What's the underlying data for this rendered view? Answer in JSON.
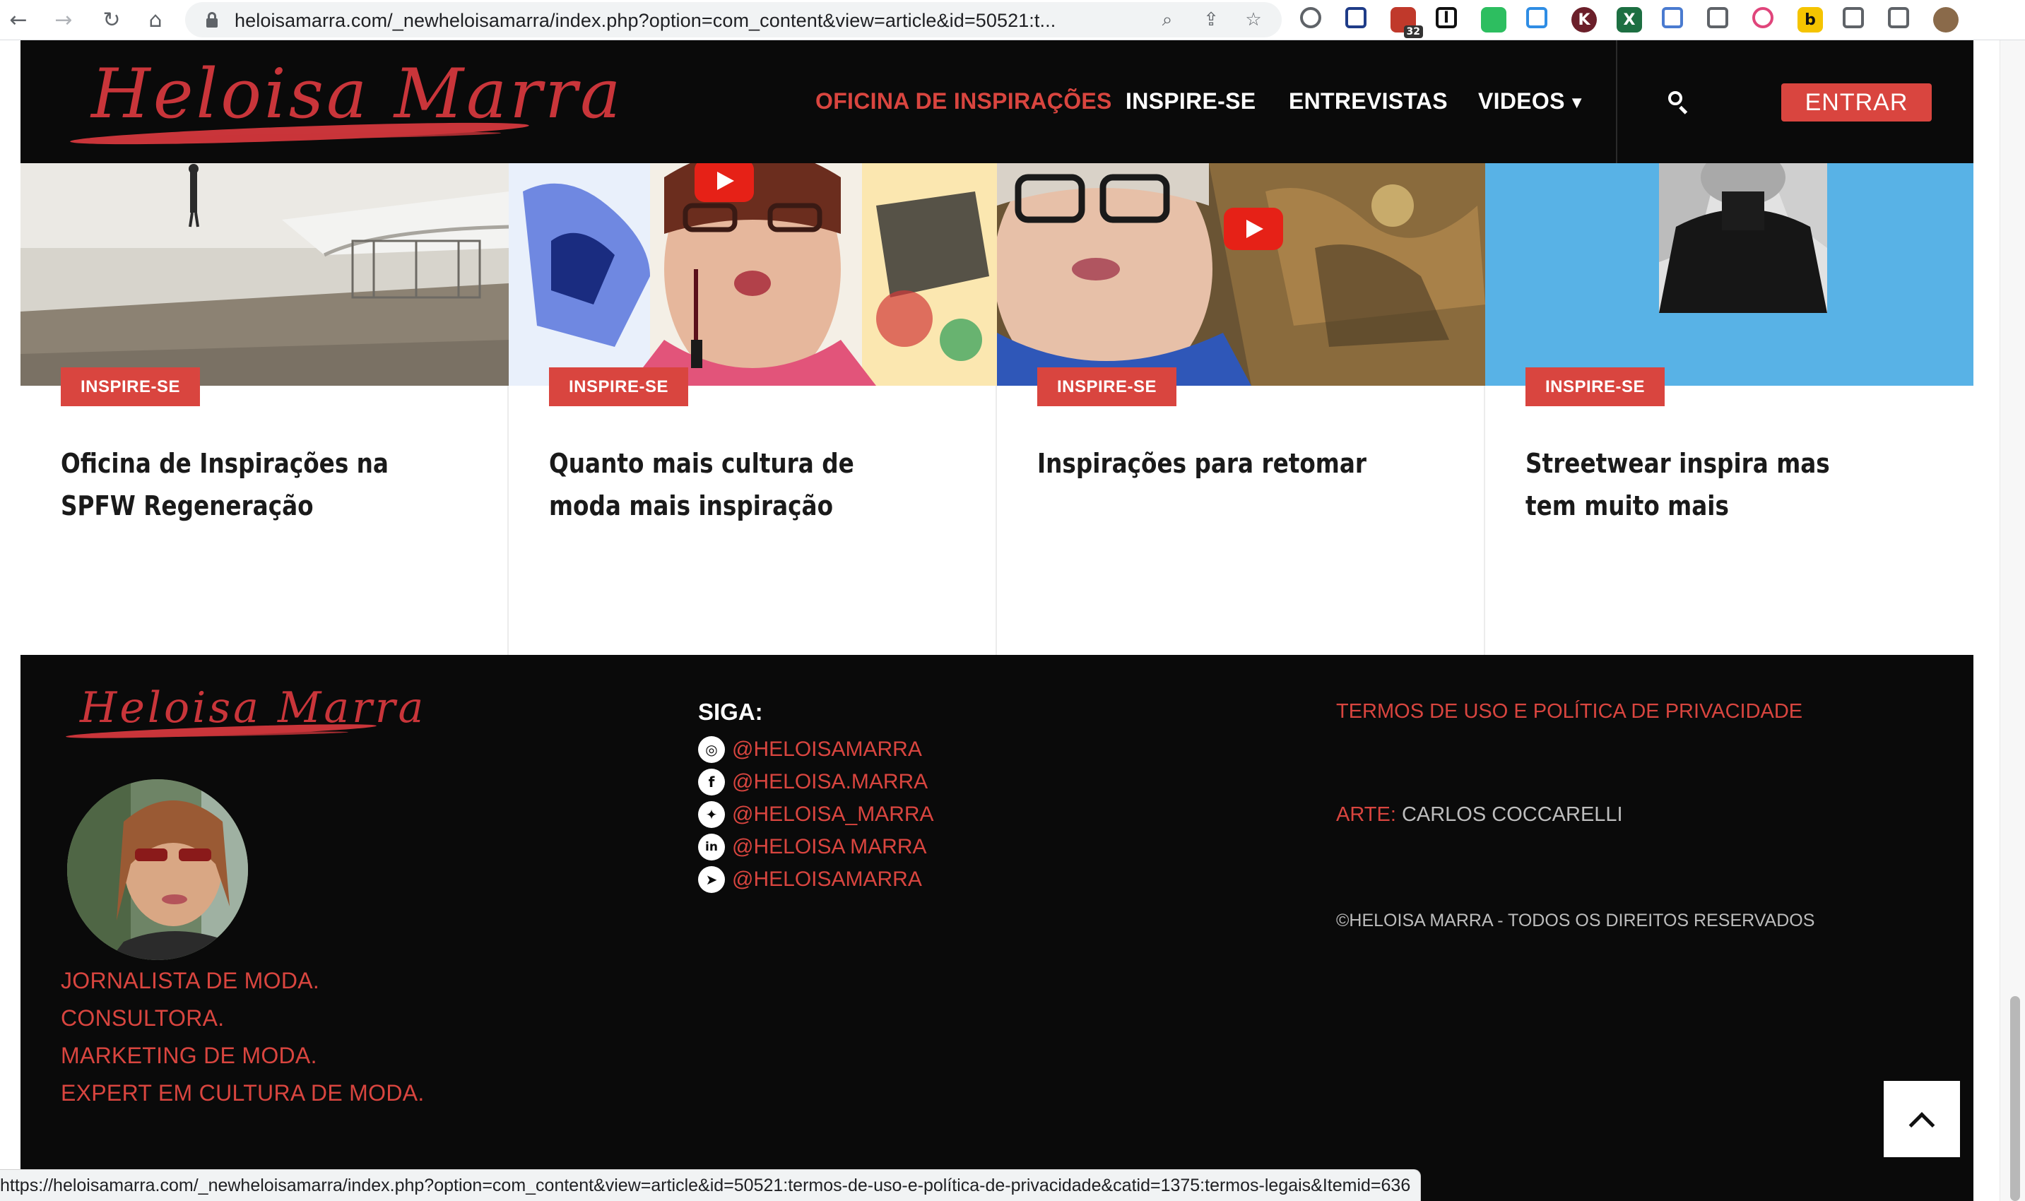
{
  "browser": {
    "url": "heloisamarra.com/_newheloisamarra/index.php?option=com_content&view=article&id=50521:t...",
    "extensions": [
      {
        "icon": "compass-icon",
        "color": "#5f6368"
      },
      {
        "icon": "eyedropper-icon",
        "color": "#1f3c88"
      },
      {
        "icon": "calendar-badge-icon",
        "color": "#c0392b",
        "badge": "32"
      },
      {
        "icon": "instapaper-icon",
        "glyph": "I",
        "color": "#111111"
      },
      {
        "icon": "evernote-icon",
        "color": "#2dbe60"
      },
      {
        "icon": "cloud-icon",
        "color": "#2f8de4"
      },
      {
        "icon": "k-icon",
        "glyph": "K",
        "color": "#6b1f2a"
      },
      {
        "icon": "x-sheet-icon",
        "glyph": "X",
        "color": "#1d6f42"
      },
      {
        "icon": "translate-icon",
        "color": "#4a7bd0"
      },
      {
        "icon": "pin-icon",
        "color": "#5f6368"
      },
      {
        "icon": "download-icon",
        "color": "#e0457b"
      },
      {
        "icon": "b-icon",
        "glyph": "b",
        "color": "#f5c400"
      },
      {
        "icon": "puzzle-icon",
        "color": "#5f6368"
      },
      {
        "icon": "sidepanel-icon",
        "color": "#5f6368"
      },
      {
        "icon": "profile-icon",
        "color": "#8a6a4a"
      }
    ],
    "status_url": "https://heloisamarra.com/_newheloisamarra/index.php?option=com_content&view=article&id=50521:termos-de-uso-e-política-de-privacidade&catid=1375:termos-legais&Itemid=636"
  },
  "header": {
    "logo_text": "Heloisa Marra",
    "menu": [
      {
        "label": "OFICINA DE INSPIRAÇÕES",
        "active": true
      },
      {
        "label": "INSPIRE-SE",
        "active": false
      },
      {
        "label": "ENTREVISTAS",
        "active": false
      },
      {
        "label": "VIDEOS",
        "active": false
      }
    ],
    "login_label": "ENTRAR"
  },
  "cards": [
    {
      "badge": "INSPIRE-SE",
      "title": "Oficina de Inspirações na SPFW Regeneração"
    },
    {
      "badge": "INSPIRE-SE",
      "title": "Quanto mais cultura de moda mais inspiração"
    },
    {
      "badge": "INSPIRE-SE",
      "title": "Inspirações para retomar"
    },
    {
      "badge": "INSPIRE-SE",
      "title": "Streetwear inspira mas tem muito mais"
    }
  ],
  "footer": {
    "logo_text": "Heloisa Marra",
    "bio": [
      "JORNALISTA DE MODA.",
      "CONSULTORA.",
      "MARKETING DE MODA.",
      "EXPERT EM CULTURA DE MODA."
    ],
    "siga_label": "SIGA:",
    "social": [
      {
        "icon": "instagram-icon",
        "handle": "@HELOISAMARRA"
      },
      {
        "icon": "facebook-icon",
        "handle": "@HELOISA.MARRA"
      },
      {
        "icon": "twitter-icon",
        "handle": "@HELOISA_MARRA"
      },
      {
        "icon": "linkedin-icon",
        "handle": "@HELOISA MARRA"
      },
      {
        "icon": "telegram-icon",
        "handle": "@HELOISAMARRA"
      }
    ],
    "terms_label": "TERMOS DE USO E POLÍTICA DE PRIVACIDADE",
    "art_label": "ARTE:",
    "art_name": "CARLOS COCCARELLI",
    "copyright": "©HELOISA MARRA - TODOS OS DIREITOS RESERVADOS"
  },
  "colors": {
    "accent": "#d9453f",
    "dark": "#0a0a0a"
  }
}
